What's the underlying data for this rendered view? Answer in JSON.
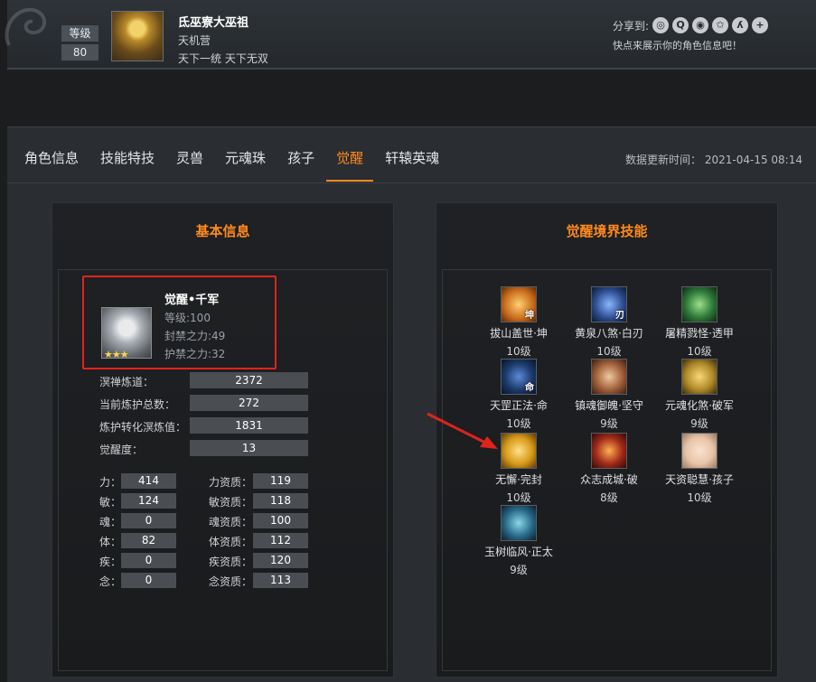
{
  "profile": {
    "level_label": "等级",
    "level_value": "80",
    "name": "氐巫寮大巫祖",
    "guild": "天机营",
    "server": "天下一统 天下无双",
    "share_label": "分享到:",
    "share_tip": "快点来展示你的角色信息吧！",
    "share_icons": [
      "wechat-icon",
      "qzone-icon",
      "weibo-icon",
      "star-icon",
      "people-icon",
      "plus-icon"
    ]
  },
  "tabs": [
    {
      "label": "角色信息",
      "active": false
    },
    {
      "label": "技能特技",
      "active": false
    },
    {
      "label": "灵兽",
      "active": false
    },
    {
      "label": "元魂珠",
      "active": false
    },
    {
      "label": "孩子",
      "active": false
    },
    {
      "label": "觉醒",
      "active": true
    },
    {
      "label": "轩辕英魂",
      "active": false
    }
  ],
  "updated": "数据更新时间：  2021-04-15 08:14",
  "basic": {
    "title": "基本信息",
    "awaken_name": "觉醒•千军",
    "awaken_level": "等级:100",
    "seal_power": "封禁之力:49",
    "guard_power": "护禁之力:32",
    "rows": [
      {
        "label": "溟禅炼道：",
        "value": "2372"
      },
      {
        "label": "当前炼护总数：",
        "value": "272"
      },
      {
        "label": "炼护转化溟炼值：",
        "value": "1831"
      },
      {
        "label": "觉醒度：",
        "value": "13"
      }
    ],
    "stats_left": [
      {
        "label": "力：",
        "value": "414"
      },
      {
        "label": "敏：",
        "value": "124"
      },
      {
        "label": "魂：",
        "value": "0"
      },
      {
        "label": "体：",
        "value": "82"
      },
      {
        "label": "疾：",
        "value": "0"
      },
      {
        "label": "念：",
        "value": "0"
      }
    ],
    "stats_right": [
      {
        "label": "力资质：",
        "value": "119"
      },
      {
        "label": "敏资质：",
        "value": "118"
      },
      {
        "label": "魂资质：",
        "value": "100"
      },
      {
        "label": "体资质：",
        "value": "112"
      },
      {
        "label": "疾资质：",
        "value": "120"
      },
      {
        "label": "念资质：",
        "value": "113"
      }
    ],
    "stars": "★★★"
  },
  "skills": {
    "title": "觉醒境界技能",
    "items": [
      {
        "name": "拔山盖世·坤",
        "level": "10级",
        "glyph": "坤",
        "color": "#c86a1a"
      },
      {
        "name": "黄泉八煞·白刃",
        "level": "10级",
        "glyph": "刃",
        "color": "#2a4a8a"
      },
      {
        "name": "屠精戮怪·透甲",
        "level": "10级",
        "glyph": "",
        "color": "#2f7a3a"
      },
      {
        "name": "天罡正法·命",
        "level": "10级",
        "glyph": "命",
        "color": "#1d3a6a"
      },
      {
        "name": "镇魂御魄·坚守",
        "level": "9级",
        "glyph": "",
        "color": "#a0603a"
      },
      {
        "name": "元魂化煞·破军",
        "level": "9级",
        "glyph": "",
        "color": "#b08a2a"
      },
      {
        "name": "无懈·完封",
        "level": "10级",
        "glyph": "",
        "color": "#d89a1a"
      },
      {
        "name": "众志成城·破",
        "level": "8级",
        "glyph": "",
        "color": "#a02a1a"
      },
      {
        "name": "天资聪慧·孩子",
        "level": "10级",
        "glyph": "",
        "color": "#e8c4a8"
      },
      {
        "name": "玉树临风·正太",
        "level": "9级",
        "glyph": "",
        "color": "#2a6a8a"
      }
    ]
  }
}
